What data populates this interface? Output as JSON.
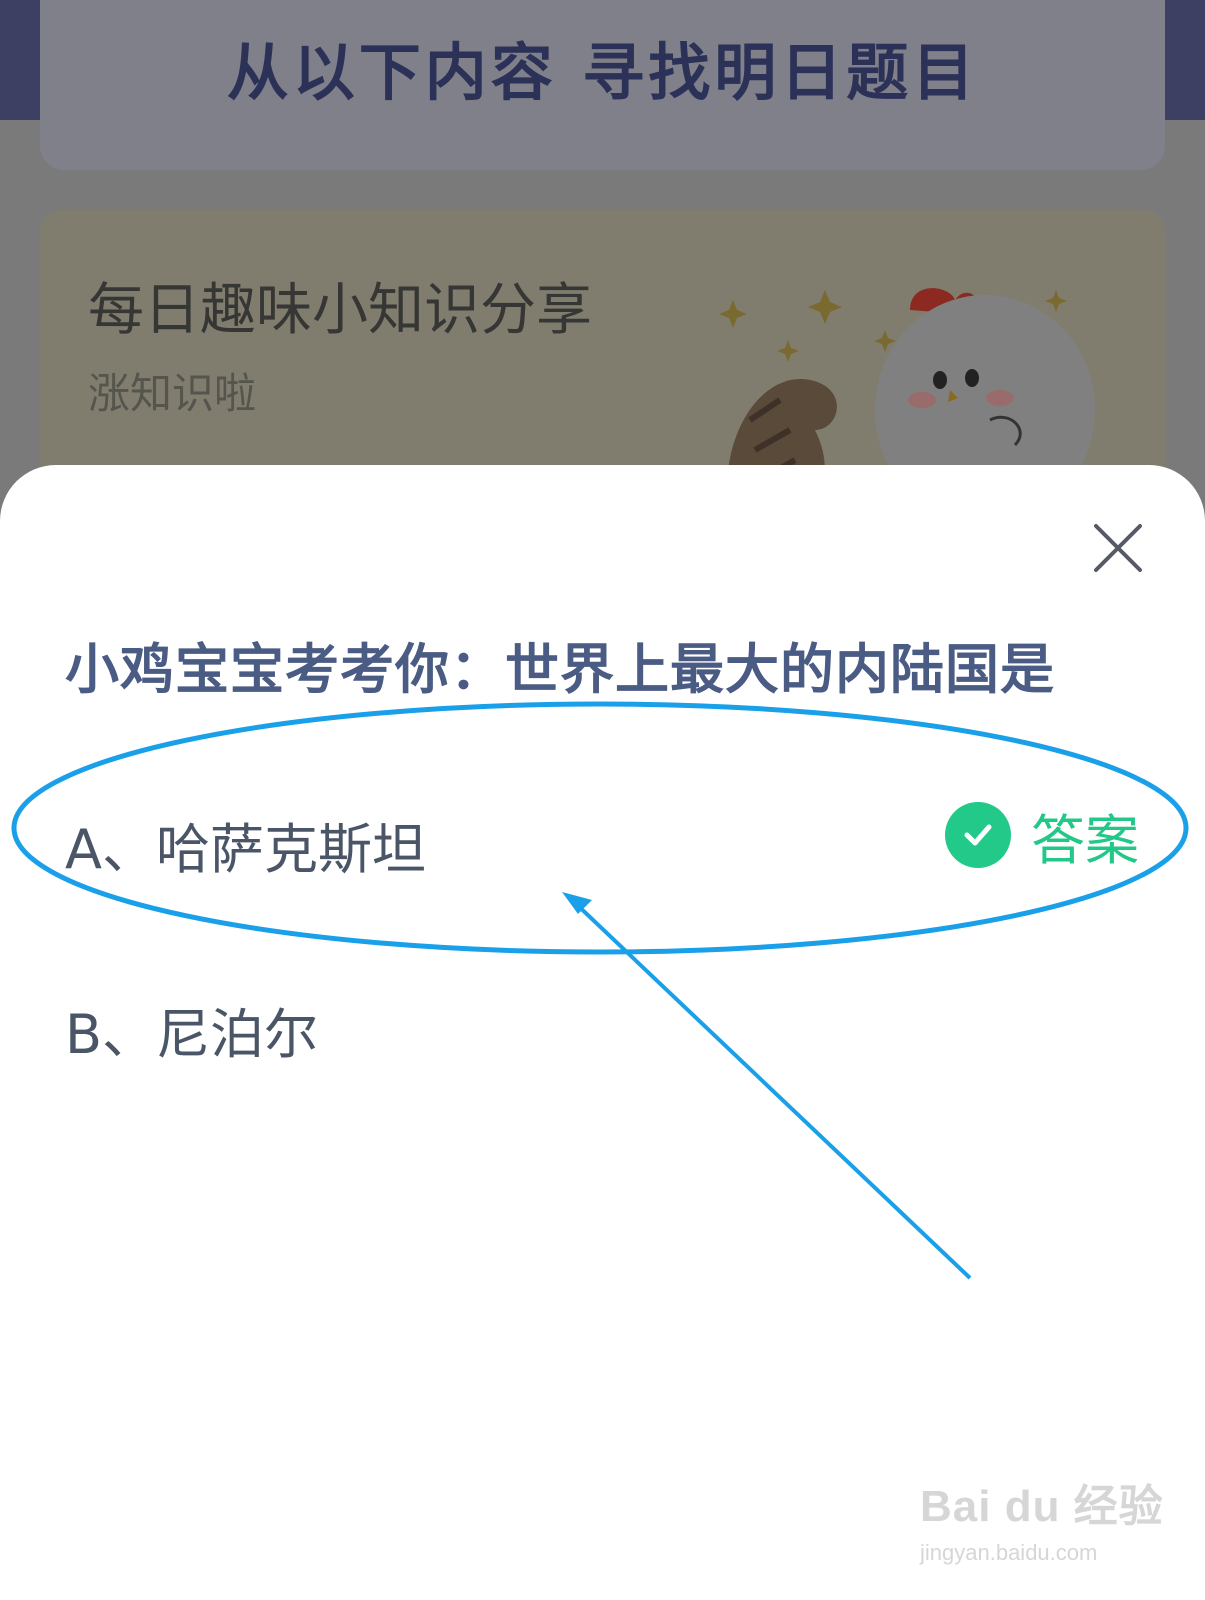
{
  "background": {
    "header_title": "从以下内容  寻找明日题目",
    "card_title": "每日趣味小知识分享",
    "card_subtitle": "涨知识啦"
  },
  "quiz": {
    "question": "小鸡宝宝考考你：世界上最大的内陆国是",
    "options": [
      {
        "label": "A、哈萨克斯坦",
        "is_answer": true
      },
      {
        "label": "B、尼泊尔",
        "is_answer": false
      }
    ],
    "answer_label": "答案"
  },
  "colors": {
    "accent_green": "#22c989",
    "question_text": "#4a5b84",
    "annotation_blue": "#1aa0e8"
  },
  "icons": {
    "close": "close-icon",
    "check": "check-circle-icon"
  },
  "watermark": {
    "brand": "Bai du 经验",
    "url": "jingyan.baidu.com"
  }
}
